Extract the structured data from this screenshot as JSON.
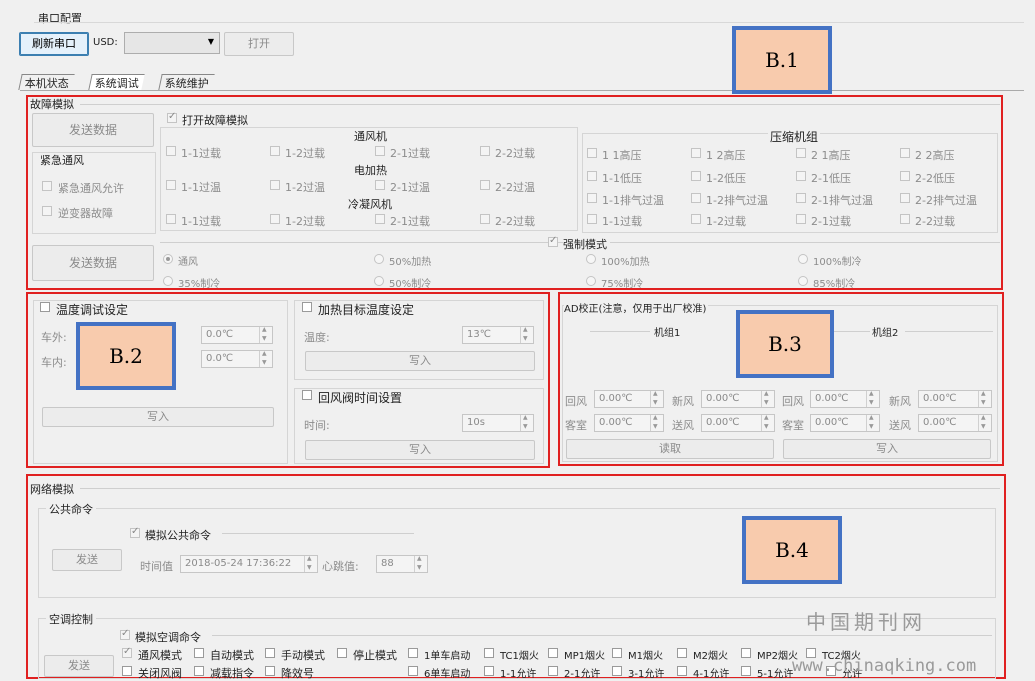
{
  "serial": {
    "title": "串口配置",
    "refresh_label": "刷新串口",
    "usb_label": "USD:",
    "open_label": "打开"
  },
  "tabs": [
    "本机状态",
    "系统调试",
    "系统维护"
  ],
  "fault": {
    "title": "故障模拟",
    "send_label": "发送数据",
    "enable_label": "打开故障模拟",
    "emergency_title": "紧急通风",
    "emergency_allow": "紧急通风允许",
    "inverter_fault": "逆变器故障",
    "vent_title": "通风机",
    "vent_items": [
      "1-1过载",
      "1-2过载",
      "2-1过载",
      "2-2过载"
    ],
    "heat_title": "电加热",
    "heat_items": [
      "1-1过温",
      "1-2过温",
      "2-1过温",
      "2-2过温"
    ],
    "cond_title": "冷凝风机",
    "cond_items": [
      "1-1过载",
      "1-2过载",
      "2-1过载",
      "2-2过载"
    ],
    "comp_title": "压缩机组",
    "comp_row1": [
      "1 1高压",
      "1 2高压",
      "2 1高压",
      "2 2高压"
    ],
    "comp_row2": [
      "1-1低压",
      "1-2低压",
      "2-1低压",
      "2-2低压"
    ],
    "comp_row3": [
      "1-1排气过温",
      "1-2排气过温",
      "2-1排气过温",
      "2-2排气过温"
    ],
    "comp_row4": [
      "1-1过载",
      "1-2过载",
      "2-1过载",
      "2-2过载"
    ],
    "send2_label": "发送数据",
    "force_label": "强制模式",
    "force_row1": [
      "通风",
      "50%加热",
      "100%加热",
      "100%制冷"
    ],
    "force_row2": [
      "35%制冷",
      "50%制冷",
      "75%制冷",
      "85%制冷"
    ]
  },
  "temp": {
    "title": "温度调试设定",
    "outside_label": "车外:",
    "outside_value": "0.0℃",
    "inside_label": "车内:",
    "inside_value": "0.0℃",
    "write_label": "写入",
    "heat_title": "加热目标温度设定",
    "heat_temp_label": "温度:",
    "heat_temp_value": "13℃",
    "heat_write": "写入",
    "valve_title": "回风阀时间设置",
    "valve_time_label": "时间:",
    "valve_time_value": "10s",
    "valve_write": "写入"
  },
  "ad": {
    "title": "AD校正(注意，仅用于出厂校准)",
    "unit1": "机组1",
    "unit2": "机组2",
    "return_label": "回风",
    "fresh_label": "新风",
    "cabin_label": "客室",
    "supply_label": "送风",
    "value": "0.00℃",
    "read_label": "读取",
    "write_label": "写入"
  },
  "net": {
    "title": "网络模拟",
    "public_title": "公共命令",
    "public_check": "模拟公共命令",
    "send_label": "发送",
    "time_label": "时间值",
    "time_value": "2018-05-24 17:36:22",
    "heartbeat_label": "心跳值:",
    "heartbeat_value": "88",
    "ac_title": "空调控制",
    "ac_check": "模拟空调命令",
    "ac_send": "发送",
    "ac_row1": [
      "通风模式",
      "自动模式",
      "手动模式",
      "停止模式",
      "1单车启动",
      "TC1烟火",
      "MP1烟火",
      "M1烟火",
      "M2烟火",
      "MP2烟火",
      "TC2烟火"
    ],
    "ac_row2": [
      "关闭风阀",
      "减载指令",
      "降效号",
      "6单车启动",
      "1-1允许",
      "2-1允许",
      "3-1允许",
      "4-1允许",
      "5-1允许",
      "允许"
    ]
  },
  "badges": {
    "b1": "B.1",
    "b2": "B.2",
    "b3": "B.3",
    "b4": "B.4"
  },
  "watermark": {
    "cn": "中国期刊网",
    "url": "www.chinaqking.com"
  },
  "colors": {
    "annotation_border": "#e02020",
    "badge_border": "#4472c4",
    "badge_fill": "#f8cbad"
  }
}
